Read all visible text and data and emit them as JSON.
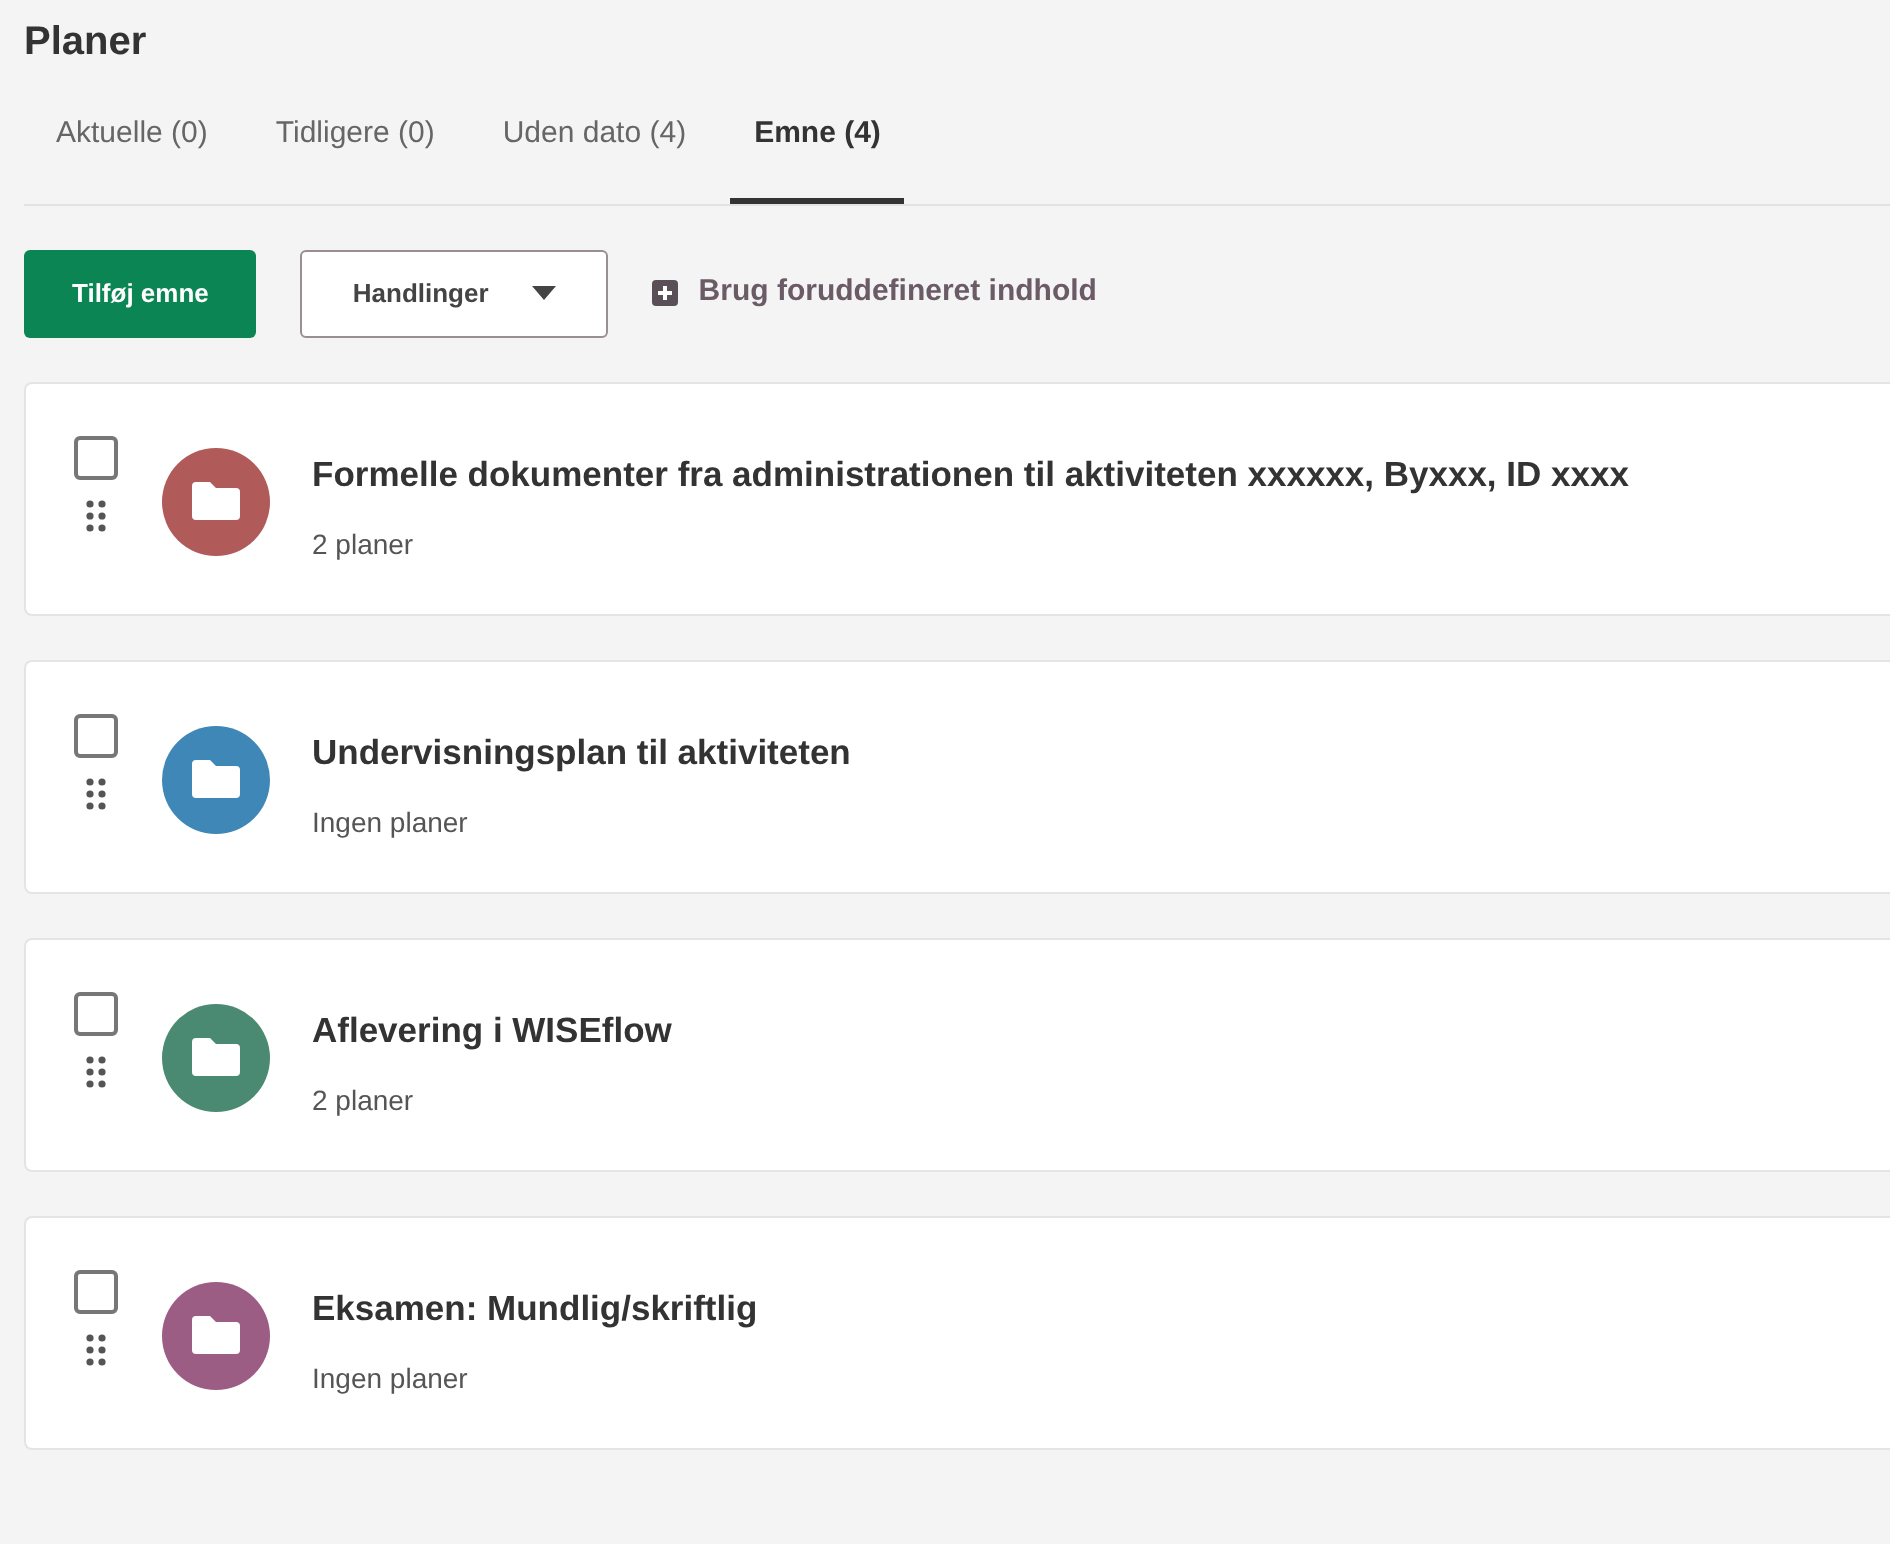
{
  "page": {
    "title": "Planer"
  },
  "tabs": [
    {
      "label": "Aktuelle (0)",
      "selected": false
    },
    {
      "label": "Tidligere (0)",
      "selected": false
    },
    {
      "label": "Uden dato (4)",
      "selected": false
    },
    {
      "label": "Emne (4)",
      "selected": true
    }
  ],
  "toolbar": {
    "add_button": "Tilføj emne",
    "actions_dropdown": "Handlinger",
    "predefined_link": "Brug foruddefineret indhold"
  },
  "topics": [
    {
      "title": "Formelle dokumenter fra administrationen til aktiviteten xxxxxx, Byxxx, ID xxxx",
      "subtitle": "2 planer",
      "checked": false,
      "color": "#b05a5a"
    },
    {
      "title": "Undervisningsplan til aktiviteten",
      "subtitle": "Ingen planer",
      "checked": false,
      "color": "#3f87b6"
    },
    {
      "title": "Aflevering i WISEflow",
      "subtitle": "2 planer",
      "checked": false,
      "color": "#4b8a72"
    },
    {
      "title": "Eksamen: Mundlig/skriftlig",
      "subtitle": "Ingen planer",
      "checked": false,
      "color": "#9c5d84"
    }
  ]
}
